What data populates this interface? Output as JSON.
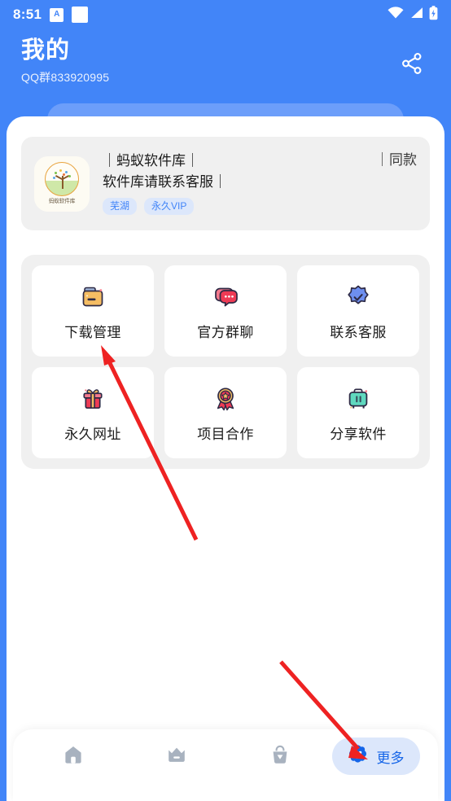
{
  "statusbar": {
    "time": "8:51",
    "badge_letter": "A",
    "icons": [
      "notification-badge-a",
      "white-square-icon",
      "wifi-icon",
      "signal-icon",
      "battery-charging-icon"
    ]
  },
  "header": {
    "title": "我的",
    "subtitle": "QQ群833920995",
    "share_icon": "share-icon"
  },
  "profile": {
    "avatar_name": "蚂蚁软件库",
    "line1": "｜蚂蚁软件库｜",
    "line2": "软件库请联系客服｜",
    "right_label": "｜同款",
    "tags": [
      "芜湖",
      "永久VIP"
    ]
  },
  "grid": {
    "rows": [
      [
        {
          "label": "下载管理",
          "icon": "folder-icon"
        },
        {
          "label": "官方群聊",
          "icon": "chat-bubbles-icon"
        },
        {
          "label": "联系客服",
          "icon": "verified-badge-icon"
        }
      ],
      [
        {
          "label": "永久网址",
          "icon": "gift-icon"
        },
        {
          "label": "项目合作",
          "icon": "medal-icon"
        },
        {
          "label": "分享软件",
          "icon": "suitcase-icon"
        }
      ]
    ]
  },
  "bottom_nav": {
    "items": [
      {
        "label": "",
        "icon": "home-icon",
        "active": false
      },
      {
        "label": "",
        "icon": "crown-icon",
        "active": false
      },
      {
        "label": "",
        "icon": "bag-icon",
        "active": false
      },
      {
        "label": "更多",
        "icon": "more-flower-icon",
        "active": true
      }
    ]
  },
  "colors": {
    "brand_blue": "#4285F8",
    "stack_blue": "#6C9EFA",
    "panel_gray": "#F0F0F0",
    "tag_bg": "#DCE7FB",
    "tag_text": "#4285F8",
    "annotation_red": "#EE2222",
    "nav_inactive": "#A8B2BF",
    "nav_active_text": "#1565E8"
  },
  "annotations": [
    {
      "name": "arrow-to-download-management"
    },
    {
      "name": "arrow-to-more-tab"
    }
  ]
}
